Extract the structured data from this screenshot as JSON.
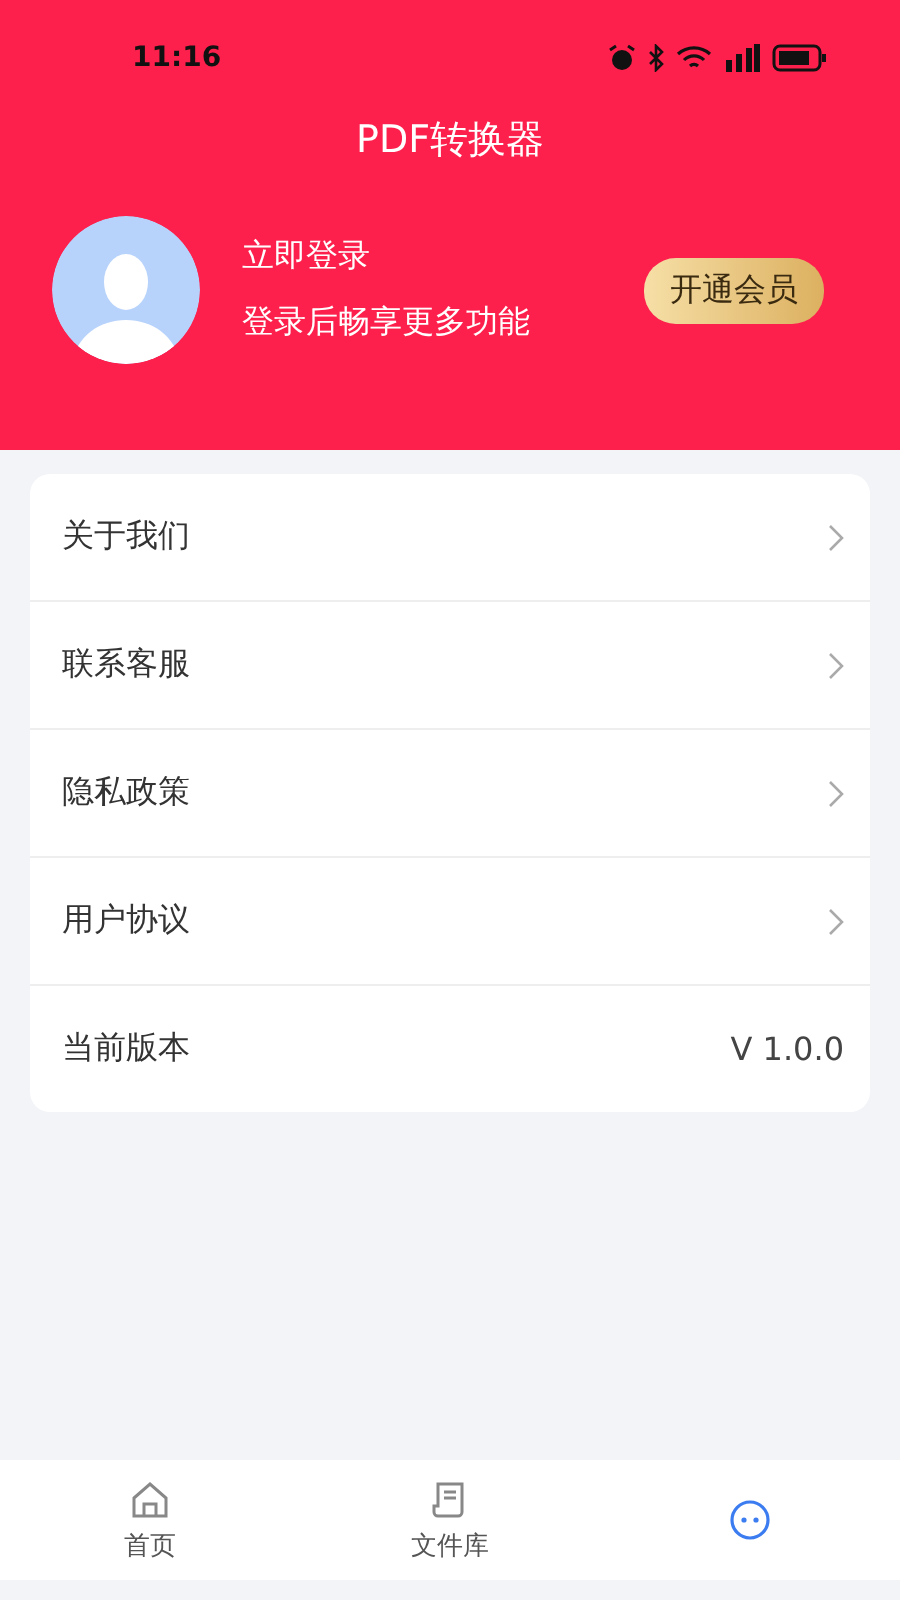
{
  "status_bar": {
    "time": "11:16"
  },
  "header": {
    "title": "PDF转换器"
  },
  "profile": {
    "name": "立即登录",
    "subtitle": "登录后畅享更多功能",
    "vip_button": "开通会员"
  },
  "menu": [
    {
      "label": "关于我们",
      "kind": "link"
    },
    {
      "label": "联系客服",
      "kind": "link"
    },
    {
      "label": "隐私政策",
      "kind": "link"
    },
    {
      "label": "用户协议",
      "kind": "link"
    },
    {
      "label": "当前版本",
      "kind": "value",
      "value": "V 1.0.0"
    }
  ],
  "tabs": [
    {
      "label": "首页",
      "kind": "home",
      "selected": false
    },
    {
      "label": "文件库",
      "kind": "files",
      "selected": false
    },
    {
      "kind": "chat",
      "selected": true
    }
  ]
}
